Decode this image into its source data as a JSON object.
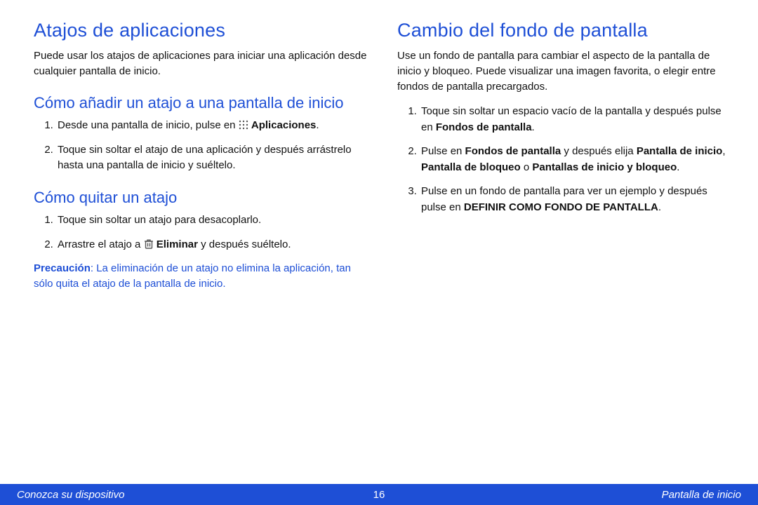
{
  "left": {
    "h1": "Atajos de aplicaciones",
    "intro": "Puede usar los atajos de aplicaciones para iniciar una aplicación desde cualquier pantalla de inicio.",
    "h2_add": "Cómo añadir un atajo a una pantalla de inicio",
    "add_step1_pre": "Desde una pantalla de inicio, pulse en ",
    "add_step1_bold": "Aplicaciones",
    "add_step1_post": ".",
    "add_step2": "Toque sin soltar el atajo de una aplicación y después arrástrelo hasta una pantalla de inicio y suéltelo.",
    "h2_remove": "Cómo quitar un atajo",
    "rem_step1": "Toque sin soltar un atajo para desacoplarlo.",
    "rem_step2_pre": "Arrastre el atajo a ",
    "rem_step2_bold": "Eliminar",
    "rem_step2_post": " y después suéltelo.",
    "caution_label": "Precaución",
    "caution_text": ": La eliminación de un atajo no elimina la aplicación, tan sólo quita el atajo de la pantalla de inicio."
  },
  "right": {
    "h1": "Cambio del fondo de pantalla",
    "intro": "Use un fondo de pantalla para cambiar el aspecto de la pantalla de inicio y bloqueo. Puede visualizar una imagen favorita, o elegir entre fondos de pantalla precargados.",
    "s1_pre": "Toque sin soltar un espacio vacío de la pantalla y después pulse en ",
    "s1_bold": "Fondos de pantalla",
    "s1_post": ".",
    "s2_pre": "Pulse en ",
    "s2_b1": "Fondos de pantalla",
    "s2_mid1": " y después elija ",
    "s2_b2": "Pantalla de inicio",
    "s2_comma": ", ",
    "s2_b3": "Pantalla de bloqueo",
    "s2_or": " o ",
    "s2_b4": "Pantallas de inicio y bloqueo",
    "s2_post": ".",
    "s3_pre": "Pulse en un fondo de pantalla para ver un ejemplo y después pulse en ",
    "s3_bold": "DEFINIR COMO FONDO DE PANTALLA",
    "s3_post": "."
  },
  "footer": {
    "left": "Conozca su dispositivo",
    "center": "16",
    "right": "Pantalla de inicio"
  }
}
